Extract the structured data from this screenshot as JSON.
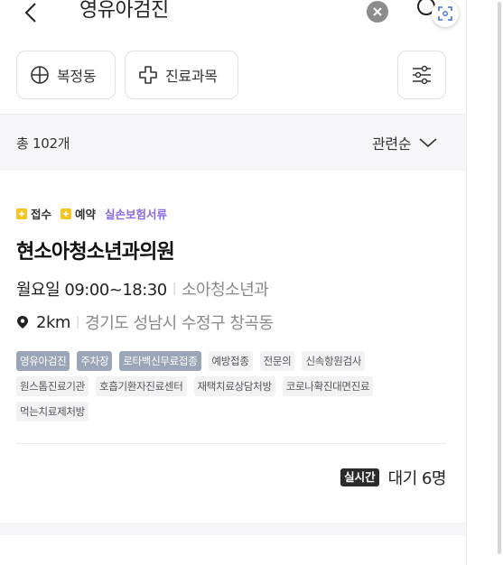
{
  "header": {
    "search_query": "영유아검진"
  },
  "filters": {
    "location_label": "복정동",
    "department_label": "진료과목"
  },
  "results": {
    "count_label": "총 102개",
    "sort_label": "관련순"
  },
  "clinic": {
    "badges": {
      "reception": "접수",
      "reservation": "예약",
      "insurance": "실손보험서류"
    },
    "name": "현소아청소년과의원",
    "day_hours": "월요일 09:00~18:30",
    "department": "소아청소년과",
    "distance": "2km",
    "address": "경기도 성남시 수정구 창곡동",
    "tags": [
      {
        "label": "영유아검진",
        "highlight": true
      },
      {
        "label": "주차장",
        "highlight": true
      },
      {
        "label": "로타백신무료접종",
        "highlight": true
      },
      {
        "label": "예방접종",
        "highlight": false
      },
      {
        "label": "전문의",
        "highlight": false
      },
      {
        "label": "신속항원검사",
        "highlight": false
      },
      {
        "label": "원스톱진료기관",
        "highlight": false
      },
      {
        "label": "호흡기환자진료센터",
        "highlight": false
      },
      {
        "label": "재택치료상담처방",
        "highlight": false
      },
      {
        "label": "코로나확진대면진료",
        "highlight": false
      },
      {
        "label": "먹는치료제처방",
        "highlight": false
      }
    ],
    "realtime_badge": "실시간",
    "wait_text": "대기 6명"
  },
  "colors": {
    "badge_yellow": "#f3c623",
    "insurance_purple": "#8a6ae0",
    "tag_highlight": "#9aa6b8"
  },
  "icons": {
    "back": "chevron-left-icon",
    "clear": "close-circle-icon",
    "search": "search-icon",
    "scan": "scan-icon",
    "location": "crosshair-icon",
    "department": "medical-cross-icon",
    "settings": "sliders-icon",
    "sort": "chevron-down-icon",
    "pin": "location-pin-icon"
  }
}
